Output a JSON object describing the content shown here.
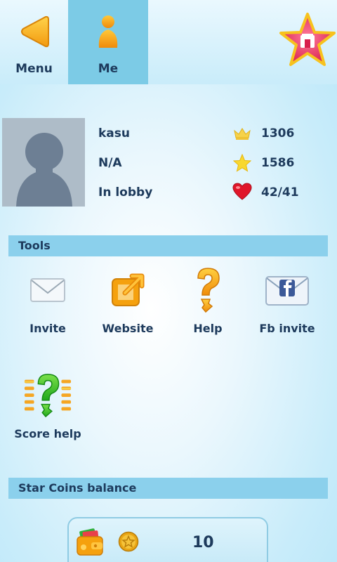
{
  "nav": {
    "menu_label": "Menu",
    "me_label": "Me"
  },
  "profile": {
    "username": "kasu",
    "status_line": "N/A",
    "location": "In lobby",
    "stats": {
      "crown": "1306",
      "star": "1586",
      "heart": "42/41"
    }
  },
  "tools": {
    "title": "Tools",
    "items": [
      {
        "label": "Invite",
        "icon": "envelope-icon"
      },
      {
        "label": "Website",
        "icon": "external-link-icon"
      },
      {
        "label": "Help",
        "icon": "question-mark-icon"
      },
      {
        "label": "Fb invite",
        "icon": "facebook-envelope-icon"
      },
      {
        "label": "Score help",
        "icon": "score-help-icon"
      }
    ]
  },
  "balance": {
    "title": "Star Coins balance",
    "amount": "10"
  },
  "colors": {
    "nav_active": "#7ccbe6",
    "section_bar": "#8bd0ec",
    "text": "#1d3a5c",
    "accent_orange": "#f5a10e",
    "star_pink": "#e8355e"
  }
}
